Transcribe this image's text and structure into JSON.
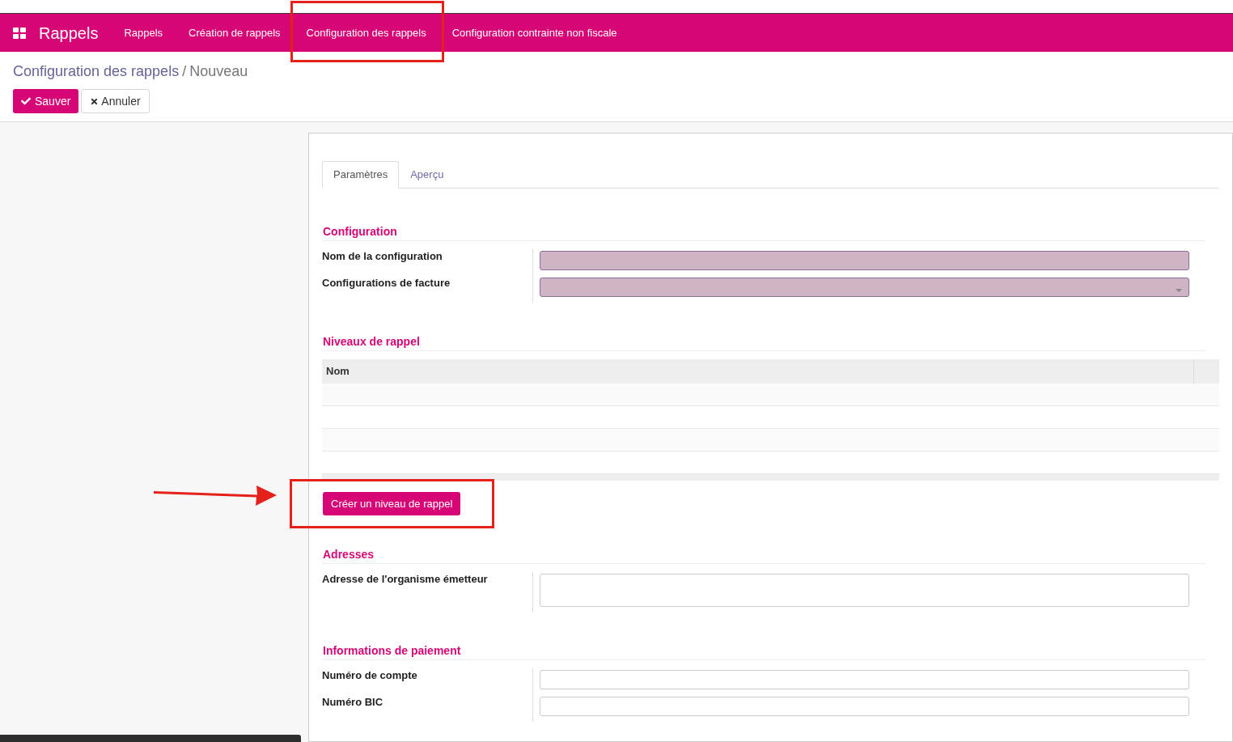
{
  "app": {
    "name": "Rappels"
  },
  "menu": [
    {
      "label": "Rappels",
      "highlighted": false
    },
    {
      "label": "Création de rappels",
      "highlighted": false
    },
    {
      "label": "Configuration des rappels",
      "highlighted": true
    },
    {
      "label": "Configuration contrainte non fiscale",
      "highlighted": false
    }
  ],
  "breadcrumb": {
    "items": [
      {
        "label": "Configuration des rappels",
        "kind": "link"
      },
      {
        "label": "Nouveau",
        "kind": "current"
      }
    ],
    "separator": "/"
  },
  "actions": [
    {
      "label": "Sauver",
      "kind": "primary"
    },
    {
      "label": "Annuler",
      "kind": "secondary"
    }
  ],
  "tabs": [
    {
      "label": "Paramètres",
      "selected": true
    },
    {
      "label": "Aperçu",
      "selected": false
    }
  ],
  "sections": [
    {
      "title": "Configuration",
      "kind": "fields",
      "fields": [
        {
          "label": "Nom de la configuration",
          "kind": "text",
          "required": true
        },
        {
          "label": "Configurations de facture",
          "kind": "select",
          "required": true
        }
      ]
    },
    {
      "title": "Niveaux de rappel",
      "kind": "list",
      "columns": [
        "Nom"
      ],
      "add_button": {
        "label": "Créer un niveau de rappel",
        "highlighted": true,
        "arrow": true
      }
    },
    {
      "title": "Adresses",
      "kind": "fields",
      "fields": [
        {
          "label": "Adresse de l'organisme émetteur",
          "kind": "textarea",
          "required": false
        }
      ]
    },
    {
      "title": "Informations de paiement",
      "kind": "fields",
      "fields": [
        {
          "label": "Numéro de compte",
          "kind": "text",
          "required": false
        },
        {
          "label": "Numéro BIC",
          "kind": "text",
          "required": false
        }
      ]
    }
  ]
}
